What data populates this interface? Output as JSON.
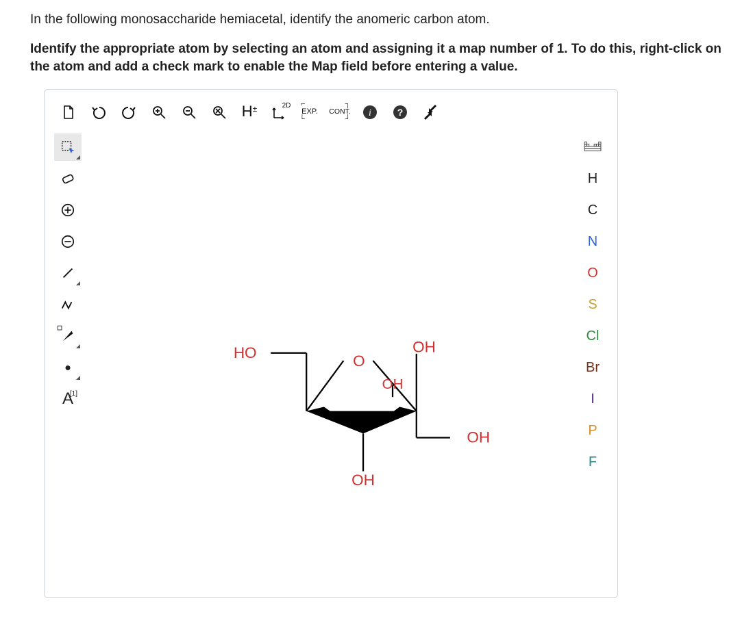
{
  "question": {
    "line1": "In the following monosaccharide hemiacetal, identify the anomeric carbon atom.",
    "line2": "Identify the appropriate atom by selecting an atom and assigning it a map number of 1. To do this, right-click on the atom and add a check mark to enable the Map field before entering a value."
  },
  "topbar": {
    "new": "new-document",
    "undo": "undo",
    "redo": "redo",
    "zoom_in": "zoom-in",
    "zoom_out": "zoom-out",
    "zoom_reset": "zoom-reset",
    "explicit_h": "H±",
    "view2d": "2D",
    "expand": "EXP.",
    "contract": "CONT.",
    "info": "info",
    "help": "?",
    "fullscreen": "fullscreen"
  },
  "leftbar": {
    "select": "rectangle-select",
    "erase": "eraser",
    "charge_plus": "+",
    "charge_minus": "−",
    "bond_single": "single-bond",
    "bond_chain": "chain",
    "stereo": "stereo-bond",
    "radical": "•",
    "map_label": "A",
    "map_sup": "[1]"
  },
  "rightbar": {
    "periodic": "periodic-table",
    "elements": [
      "H",
      "C",
      "N",
      "O",
      "S",
      "Cl",
      "Br",
      "I",
      "P",
      "F"
    ]
  },
  "molecule": {
    "labels": {
      "ho_left": "HO",
      "oh_top": "OH",
      "oh_mid": "OH",
      "oh_right": "OH",
      "oh_bottom": "OH",
      "o_ring": "O"
    }
  }
}
